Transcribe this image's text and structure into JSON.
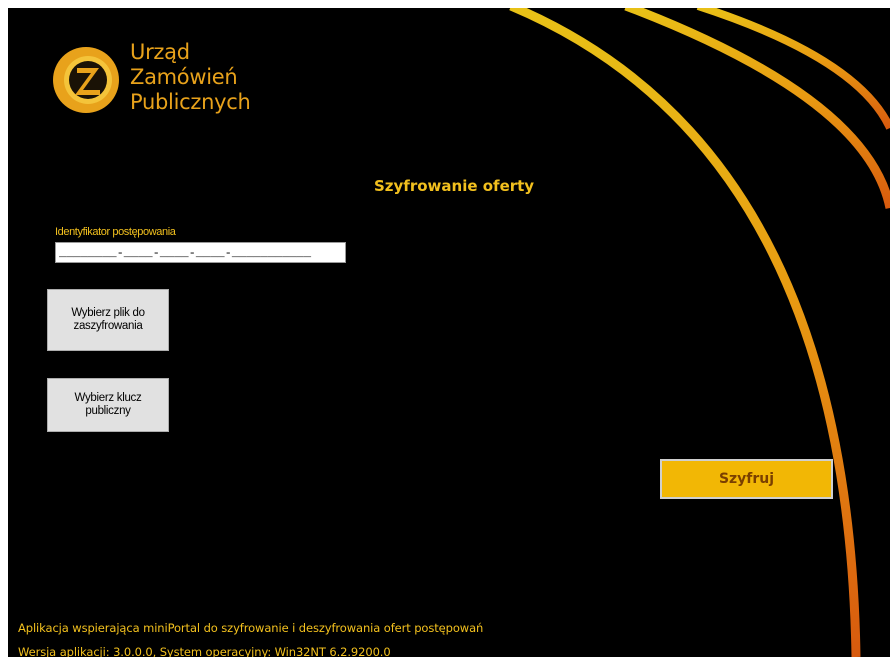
{
  "logo": {
    "lines": [
      "Urząd",
      "Zamówień",
      "Publicznych"
    ],
    "icon": "zp-logo-icon",
    "colors": {
      "orange": "#e8a21b",
      "dark": "#1a1206"
    }
  },
  "title": "Szyfrowanie oferty",
  "identifier": {
    "label": "Identyfikator postępowania",
    "value": "________-____-____-____-___________"
  },
  "buttons": {
    "select_file": "Wybierz plik do zaszyfrowania",
    "select_key": "Wybierz klucz publiczny",
    "encrypt": "Szyfruj"
  },
  "footer": {
    "description": "Aplikacja wspierająca miniPortal do szyfrowanie i deszyfrowania ofert postępowań",
    "version": "Wersja aplikacji: 3.0.0.0, System operacyjny: Win32NT  6.2.9200.0"
  },
  "colors": {
    "background": "#000000",
    "accent": "#f2c01e",
    "button_yellow": "#f2b705",
    "arc_gold": "#e8b817",
    "arc_orange": "#e06a10"
  }
}
